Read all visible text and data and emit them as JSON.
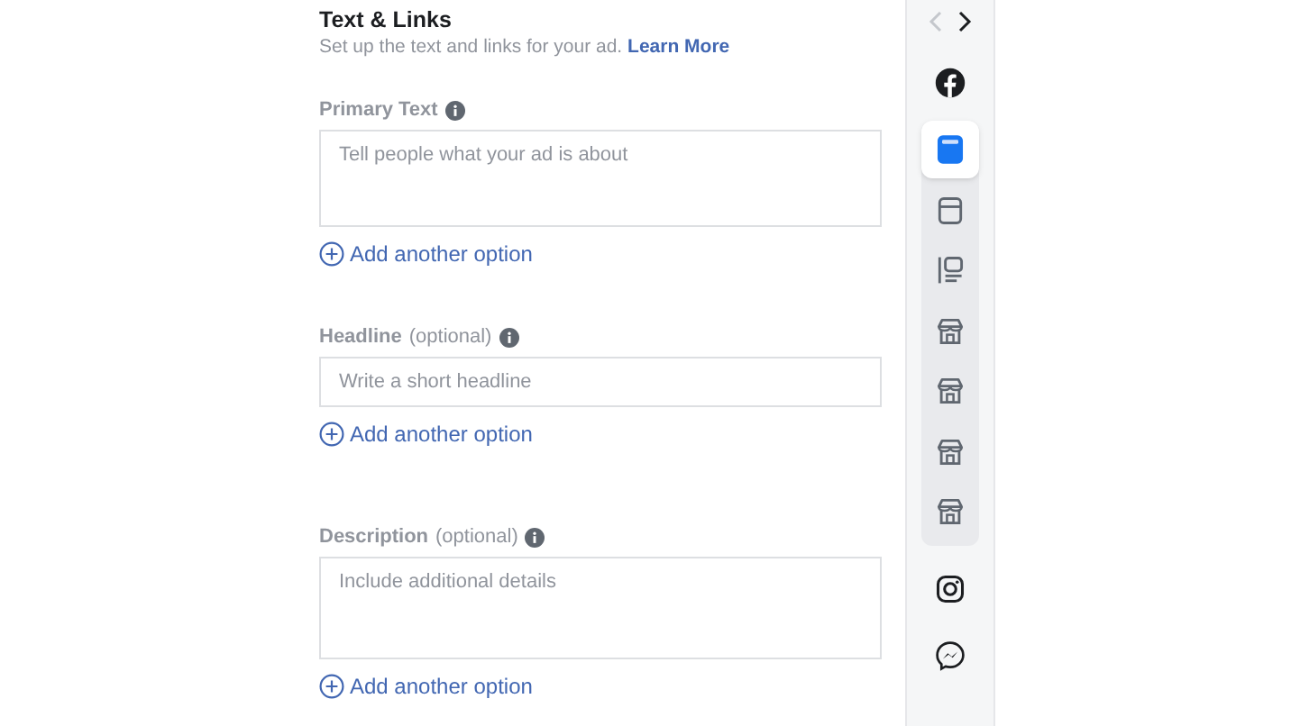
{
  "section": {
    "title": "Text & Links",
    "subtitle": "Set up the text and links for your ad.",
    "link": "Learn More"
  },
  "fields": [
    {
      "kind": "textarea",
      "label": "Primary Text",
      "placeholder": "Tell people what your ad is about",
      "add_option": "Add another option"
    },
    {
      "kind": "input",
      "label": "Headline",
      "note": "(optional)",
      "placeholder": "Write a short headline",
      "add_option": "Add another option"
    },
    {
      "kind": "textarea",
      "label": "Description",
      "note": "(optional)",
      "placeholder": "Include additional details",
      "add_option": "Add another option"
    }
  ],
  "preview_nav": {
    "prev_disabled": true
  },
  "platforms_top": [
    {
      "kind": "facebook"
    }
  ],
  "placements": [
    {
      "kind": "feed",
      "selected": true
    },
    {
      "kind": "story",
      "selected": false
    },
    {
      "kind": "column",
      "selected": false
    },
    {
      "kind": "store",
      "selected": false
    },
    {
      "kind": "store",
      "selected": false
    },
    {
      "kind": "store",
      "selected": false
    },
    {
      "kind": "store",
      "selected": false
    }
  ],
  "platforms_bottom": [
    {
      "kind": "instagram"
    },
    {
      "kind": "messenger"
    }
  ]
}
